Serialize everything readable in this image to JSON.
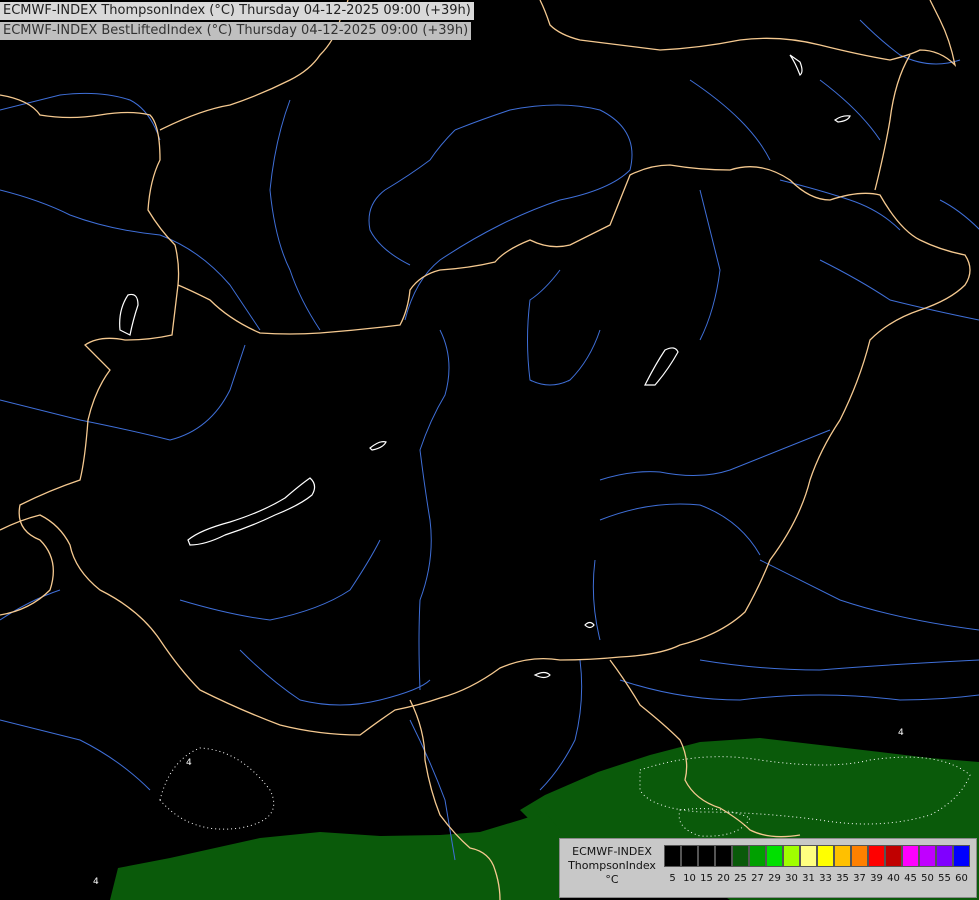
{
  "titles": {
    "line1": "ECMWF-INDEX ThompsonIndex (°C) Thursday 04-12-2025 09:00 (+39h)",
    "line2": "ECMWF-INDEX BestLiftedIndex (°C) Thursday 04-12-2025 09:00 (+39h)"
  },
  "map": {
    "background": "#000000",
    "border_color": "#f5c990",
    "river_color": "#3f6fd8",
    "lake_color": "#ffffff",
    "fill_color": "#0a5a0a",
    "contour_labels": [
      "4",
      "4",
      "4"
    ]
  },
  "legend": {
    "line1": "ECMWF-INDEX",
    "line2": "ThompsonIndex",
    "line3": "°C",
    "ticks": [
      "5",
      "10",
      "15",
      "20",
      "25",
      "27",
      "29",
      "30",
      "31",
      "33",
      "35",
      "37",
      "39",
      "40",
      "45",
      "50",
      "55",
      "60"
    ],
    "colors": [
      "#000000",
      "#000000",
      "#000000",
      "#000000",
      "#0a5a0a",
      "#00a000",
      "#00e000",
      "#a0ff00",
      "#ffff80",
      "#ffff00",
      "#ffc000",
      "#ff8000",
      "#ff0000",
      "#c00000",
      "#ff00ff",
      "#c000ff",
      "#8000ff",
      "#0000ff"
    ]
  }
}
